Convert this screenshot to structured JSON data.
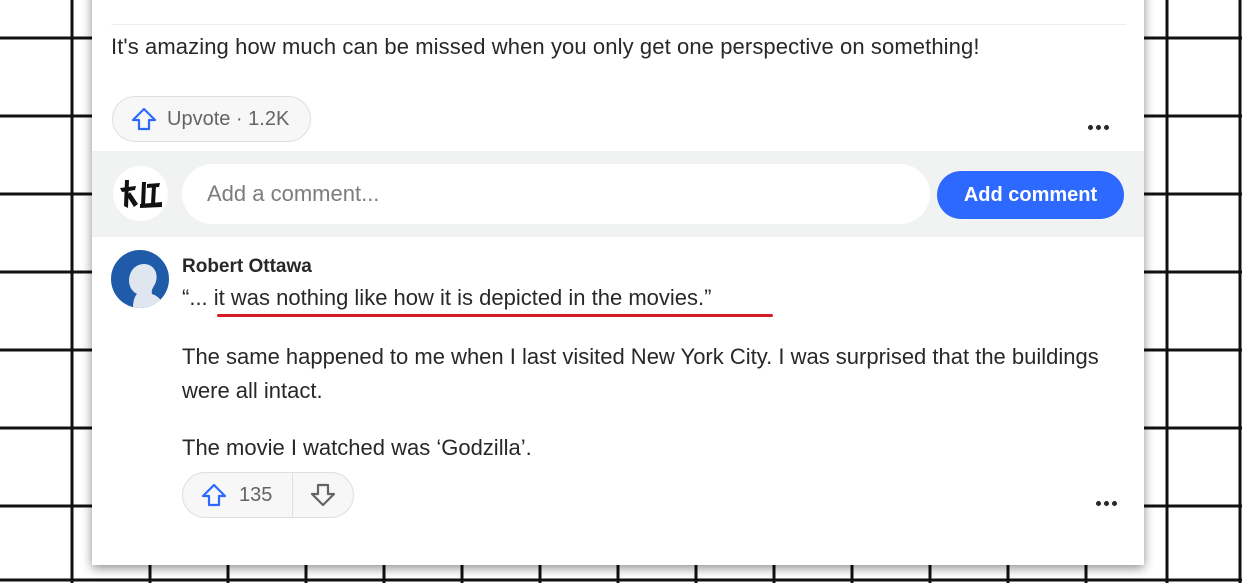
{
  "answer": {
    "text": "It's amazing how much can be missed when you only get one perspective on something!",
    "upvote_label": "Upvote · 1.2K"
  },
  "comment_box": {
    "placeholder": "Add a comment...",
    "button_label": "Add comment"
  },
  "comment": {
    "author": "Robert Ottawa",
    "quote": "“... it was nothing like how it is depicted in the movies.”",
    "paragraph1": "The same happened to me when I last visited New York City. I was surprised that the buildings were all intact.",
    "paragraph2": "The movie I watched was ‘Godzilla’.",
    "upvote_count": "135",
    "underline_color": "#d81c27"
  },
  "colors": {
    "accent": "#2e69ff",
    "upvote_icon": "#2e69ff",
    "avatar_bg": "#1f5ba8"
  },
  "icons": [
    "upvote-arrow-icon",
    "downvote-arrow-icon",
    "more-options-icon"
  ]
}
